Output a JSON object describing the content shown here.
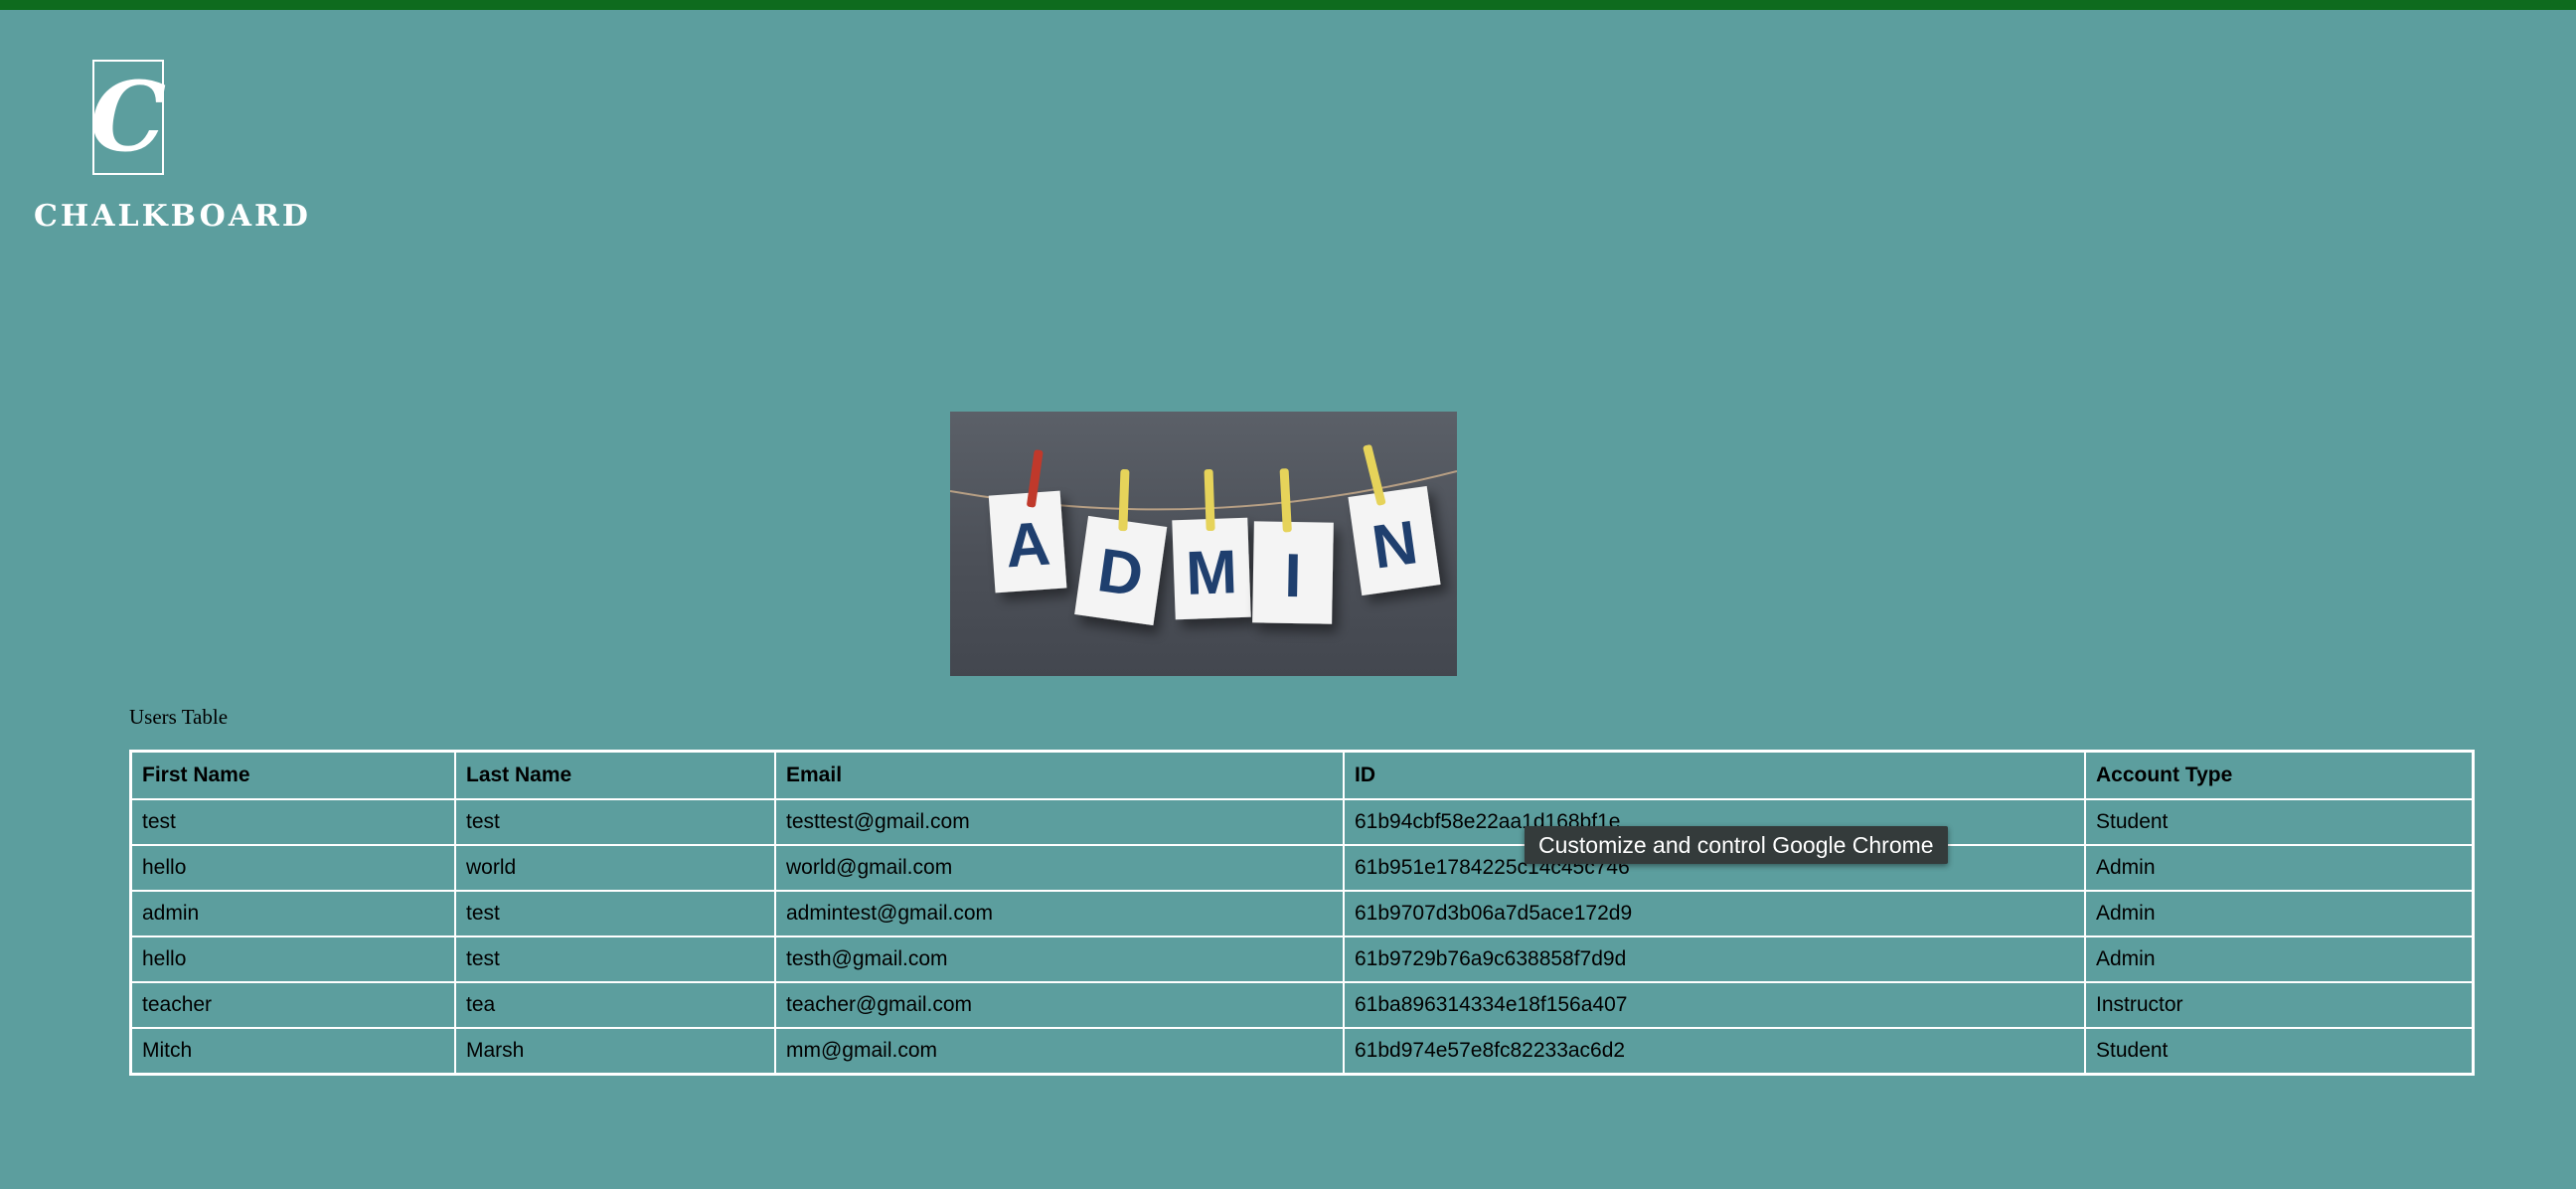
{
  "logo": {
    "letter": "C",
    "name": "CHALKBOARD"
  },
  "banner": {
    "letters": [
      "A",
      "D",
      "M",
      "I",
      "N"
    ]
  },
  "table": {
    "caption": "Users Table",
    "headers": [
      "First Name",
      "Last Name",
      "Email",
      "ID",
      "Account Type"
    ],
    "rows": [
      [
        "test",
        "test",
        "testtest@gmail.com",
        "61b94cbf58e22aa1d168bf1e",
        "Student"
      ],
      [
        "hello",
        "world",
        "world@gmail.com",
        "61b951e1784225c14c45c746",
        "Admin"
      ],
      [
        "admin",
        "test",
        "admintest@gmail.com",
        "61b9707d3b06a7d5ace172d9",
        "Admin"
      ],
      [
        "hello",
        "test",
        "testh@gmail.com",
        "61b9729b76a9c638858f7d9d",
        "Admin"
      ],
      [
        "teacher",
        "tea",
        "teacher@gmail.com",
        "61ba896314334e18f156a407",
        "Instructor"
      ],
      [
        "Mitch",
        "Marsh",
        "mm@gmail.com",
        "61bd974e57e8fc82233ac6d2",
        "Student"
      ]
    ]
  },
  "tooltip": {
    "text": "Customize and control Google Chrome"
  },
  "colors": {
    "background": "#5c9e9e",
    "top_bar": "#0e6b1e",
    "border": "#ffffff",
    "letter_ink": "#1f3f6e"
  }
}
